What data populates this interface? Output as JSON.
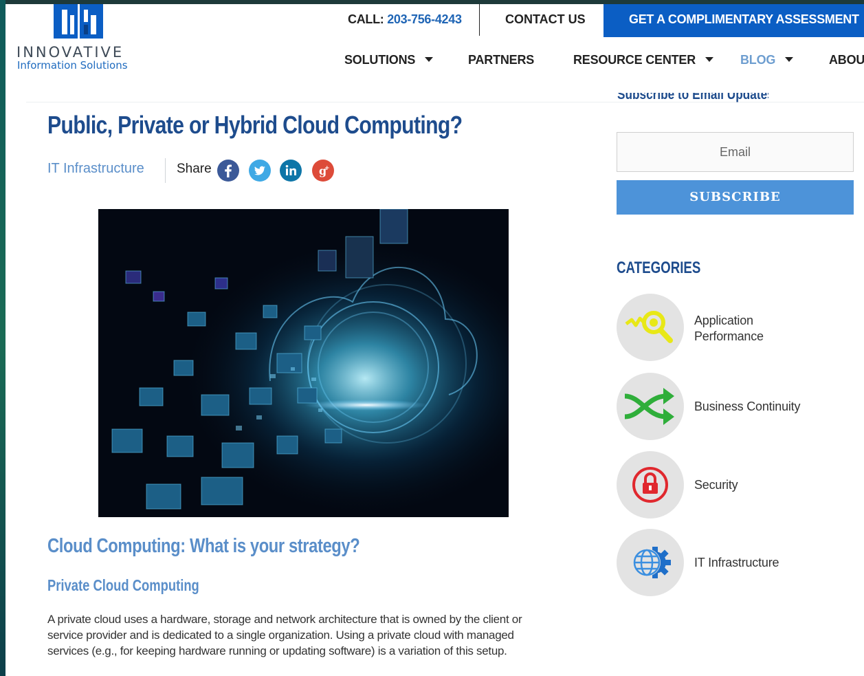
{
  "brand": {
    "name": "INNOVATIVE",
    "tagline": "Information Solutions",
    "colors": {
      "primary": "#0b5ec4",
      "heading": "#1e4c8d",
      "accent": "#5a8ec9",
      "button": "#4d93d9"
    }
  },
  "topbar": {
    "call_label": "CALL: ",
    "phone": "203-756-4243",
    "contact": "CONTACT US",
    "cta": "GET A COMPLIMENTARY ASSESSMENT"
  },
  "nav": {
    "items": [
      {
        "label": "SOLUTIONS",
        "has_dropdown": true,
        "active": false
      },
      {
        "label": "PARTNERS",
        "has_dropdown": false,
        "active": false
      },
      {
        "label": "RESOURCE CENTER",
        "has_dropdown": true,
        "active": false
      },
      {
        "label": "BLOG",
        "has_dropdown": true,
        "active": true
      },
      {
        "label": "ABOUT",
        "has_dropdown": false,
        "active": false
      }
    ]
  },
  "article": {
    "title": "Public, Private or Hybrid Cloud Computing?",
    "category": "IT Infrastructure",
    "share_label": "Share",
    "share_icons": [
      "facebook-icon",
      "twitter-icon",
      "linkedin-icon",
      "google-plus-icon"
    ],
    "hero_image": "cloud-data-cubes-image",
    "h2": "Cloud Computing: What is your strategy?",
    "h3": "Private Cloud Computing",
    "paragraph": "A private cloud uses a hardware, storage and network architecture that is owned by the client or service provider and is dedicated to a single organization. Using a private cloud with managed services (e.g., for keeping hardware running or updating software) is a variation of this setup."
  },
  "sidebar": {
    "subscribe_heading": "Subscribe to Email Updates",
    "email_placeholder": "Email",
    "subscribe_button": "SUBSCRIBE",
    "categories_heading": "CATEGORIES",
    "categories": [
      {
        "label": "Application Performance",
        "icon": "magnifier-performance-icon"
      },
      {
        "label": "Business Continuity",
        "icon": "shuffle-arrows-icon"
      },
      {
        "label": "Security",
        "icon": "lock-icon"
      },
      {
        "label": "IT Infrastructure",
        "icon": "globe-gear-icon"
      }
    ]
  }
}
